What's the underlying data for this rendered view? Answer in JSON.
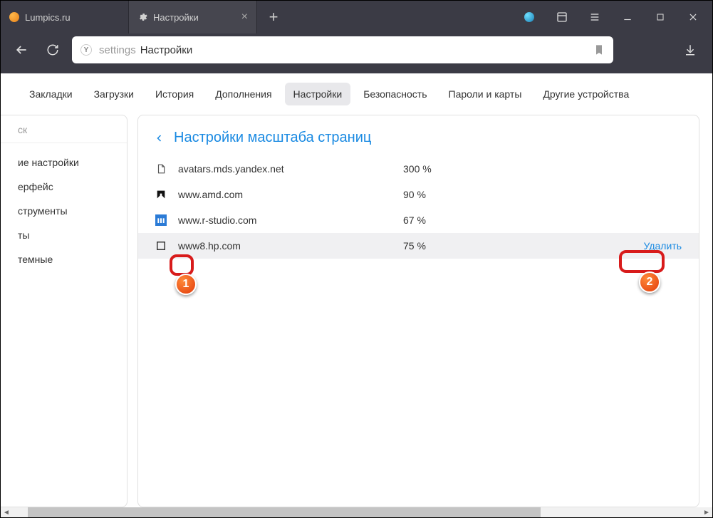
{
  "tabs": [
    {
      "title": "Lumpics.ru",
      "active": false
    },
    {
      "title": "Настройки",
      "active": true
    }
  ],
  "address": {
    "prefix": "settings",
    "page": "Настройки"
  },
  "topnav": [
    {
      "label": "Закладки",
      "active": false
    },
    {
      "label": "Загрузки",
      "active": false
    },
    {
      "label": "История",
      "active": false
    },
    {
      "label": "Дополнения",
      "active": false
    },
    {
      "label": "Настройки",
      "active": true
    },
    {
      "label": "Безопасность",
      "active": false
    },
    {
      "label": "Пароли и карты",
      "active": false
    },
    {
      "label": "Другие устройства",
      "active": false
    }
  ],
  "sidebar": {
    "search_placeholder": "ск",
    "items": [
      "ие настройки",
      "ерфейс",
      "струменты",
      "ты",
      "темные"
    ]
  },
  "panel": {
    "title": "Настройки масштаба страниц"
  },
  "sites": [
    {
      "icon": "file",
      "name": "avatars.mds.yandex.net",
      "zoom": "300 %",
      "hover": false
    },
    {
      "icon": "amd",
      "name": "www.amd.com",
      "zoom": "90 %",
      "hover": false
    },
    {
      "icon": "rstudio",
      "name": "www.r-studio.com",
      "zoom": "67 %",
      "hover": false
    },
    {
      "icon": "blank",
      "name": "www8.hp.com",
      "zoom": "75 %",
      "hover": true,
      "delete": "Удалить"
    }
  ],
  "callouts": {
    "c1": "1",
    "c2": "2"
  }
}
